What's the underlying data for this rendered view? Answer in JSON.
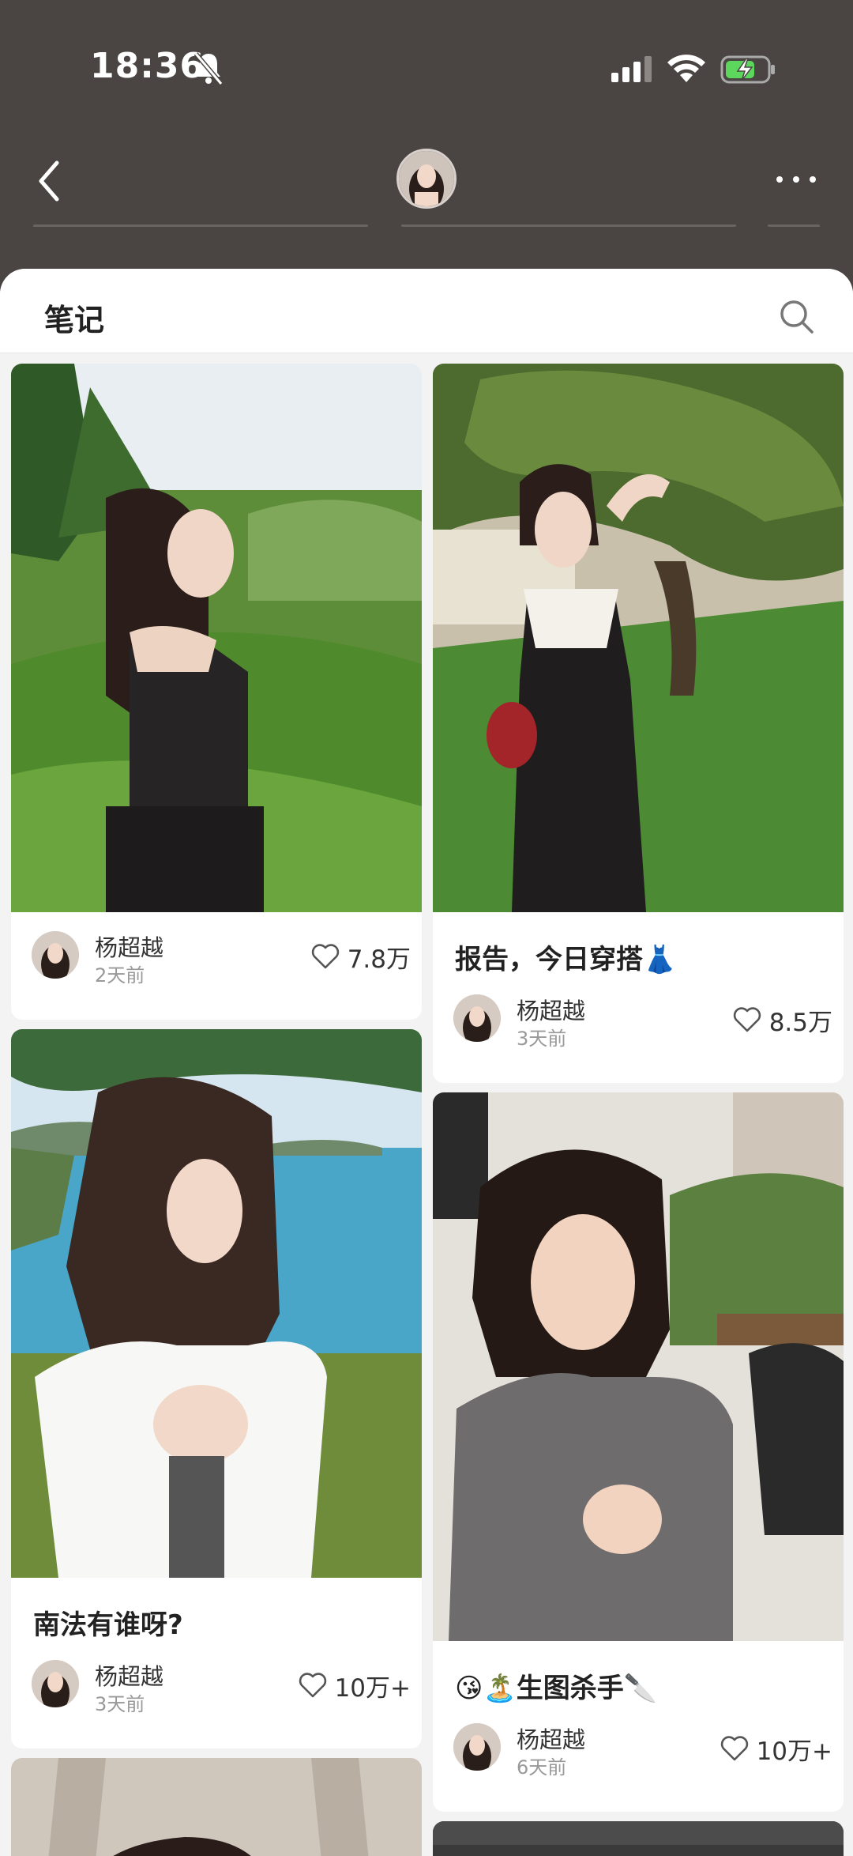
{
  "status_bar": {
    "time": "18:36"
  },
  "sheet": {
    "title": "笔记"
  },
  "notes": [
    {
      "caption": "",
      "author": "杨超越",
      "time_ago": "2天前",
      "likes": "7.8万"
    },
    {
      "caption": "报告，今日穿搭👗",
      "author": "杨超越",
      "time_ago": "3天前",
      "likes": "8.5万"
    },
    {
      "caption": "南法有谁呀?",
      "author": "杨超越",
      "time_ago": "3天前",
      "likes": "10万+"
    },
    {
      "caption": "😘🏝️生图杀手🔪",
      "author": "杨超越",
      "time_ago": "6天前",
      "likes": "10万+"
    }
  ],
  "colors": {
    "header_bg": "#4a4543",
    "sheet_bg": "#f3f3f3",
    "battery_fill": "#5cd65c"
  }
}
